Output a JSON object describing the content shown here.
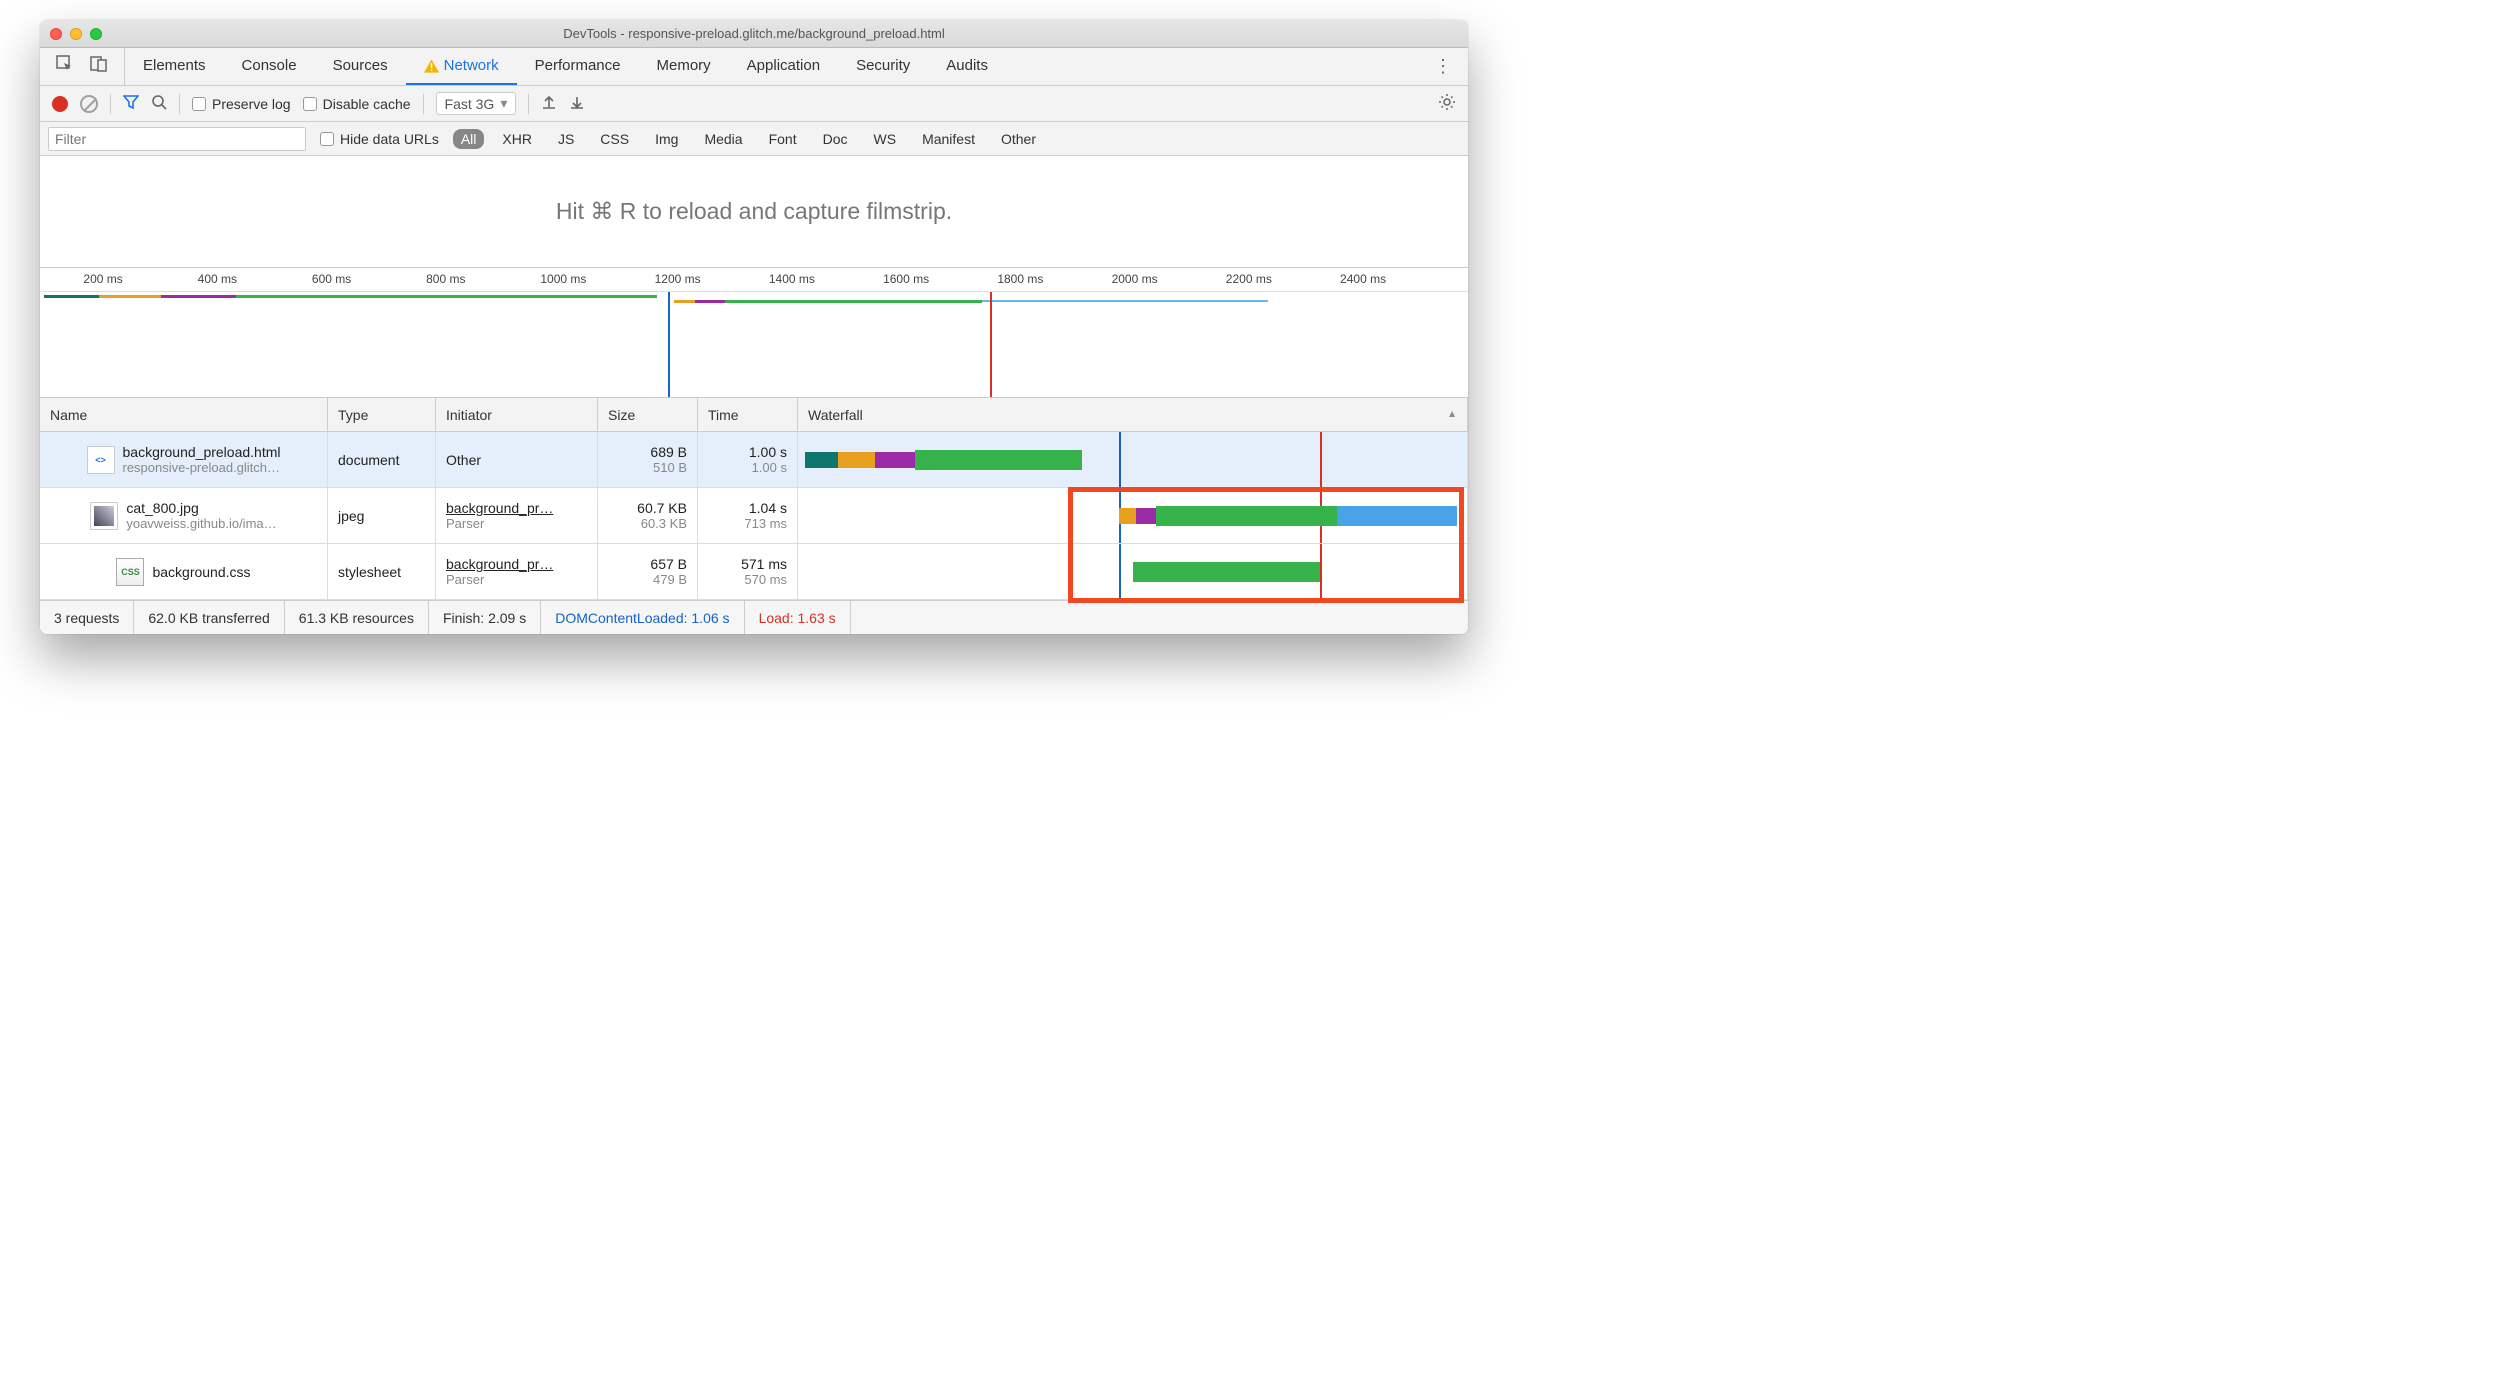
{
  "window_title": "DevTools - responsive-preload.glitch.me/background_preload.html",
  "tabs": [
    {
      "label": "Elements"
    },
    {
      "label": "Console"
    },
    {
      "label": "Sources"
    },
    {
      "label": "Network",
      "active": true,
      "warning": true
    },
    {
      "label": "Performance"
    },
    {
      "label": "Memory"
    },
    {
      "label": "Application"
    },
    {
      "label": "Security"
    },
    {
      "label": "Audits"
    }
  ],
  "toolbar": {
    "preserve_log": "Preserve log",
    "disable_cache": "Disable cache",
    "throttle": "Fast 3G"
  },
  "filterbar": {
    "placeholder": "Filter",
    "hide_data": "Hide data URLs",
    "types": [
      "All",
      "XHR",
      "JS",
      "CSS",
      "Img",
      "Media",
      "Font",
      "Doc",
      "WS",
      "Manifest",
      "Other"
    ]
  },
  "filmstrip_msg": "Hit ⌘ R to reload and capture filmstrip.",
  "ruler_ticks": [
    "200 ms",
    "400 ms",
    "600 ms",
    "800 ms",
    "1000 ms",
    "1200 ms",
    "1400 ms",
    "1600 ms",
    "1800 ms",
    "2000 ms",
    "2200 ms",
    "2400 ms"
  ],
  "columns": {
    "name": "Name",
    "type": "Type",
    "initiator": "Initiator",
    "size": "Size",
    "time": "Time",
    "waterfall": "Waterfall"
  },
  "requests": [
    {
      "name": "background_preload.html",
      "sub": "responsive-preload.glitch…",
      "type": "document",
      "initiator": "Other",
      "initiator_sub": "",
      "size": "689 B",
      "size_sub": "510 B",
      "time": "1.00 s",
      "time_sub": "1.00 s",
      "thumb": "html",
      "selected": true
    },
    {
      "name": "cat_800.jpg",
      "sub": "yoavweiss.github.io/ima…",
      "type": "jpeg",
      "initiator": "background_pr…",
      "initiator_sub": "Parser",
      "size": "60.7 KB",
      "size_sub": "60.3 KB",
      "time": "1.04 s",
      "time_sub": "713 ms",
      "thumb": "img",
      "selected": false
    },
    {
      "name": "background.css",
      "sub": "",
      "type": "stylesheet",
      "initiator": "background_pr…",
      "initiator_sub": "Parser",
      "size": "657 B",
      "size_sub": "479 B",
      "time": "571 ms",
      "time_sub": "570 ms",
      "thumb": "css",
      "selected": false
    }
  ],
  "status": {
    "requests": "3 requests",
    "transferred": "62.0 KB transferred",
    "resources": "61.3 KB resources",
    "finish": "Finish: 2.09 s",
    "dcl": "DOMContentLoaded: 1.06 s",
    "load": "Load: 1.63 s"
  }
}
